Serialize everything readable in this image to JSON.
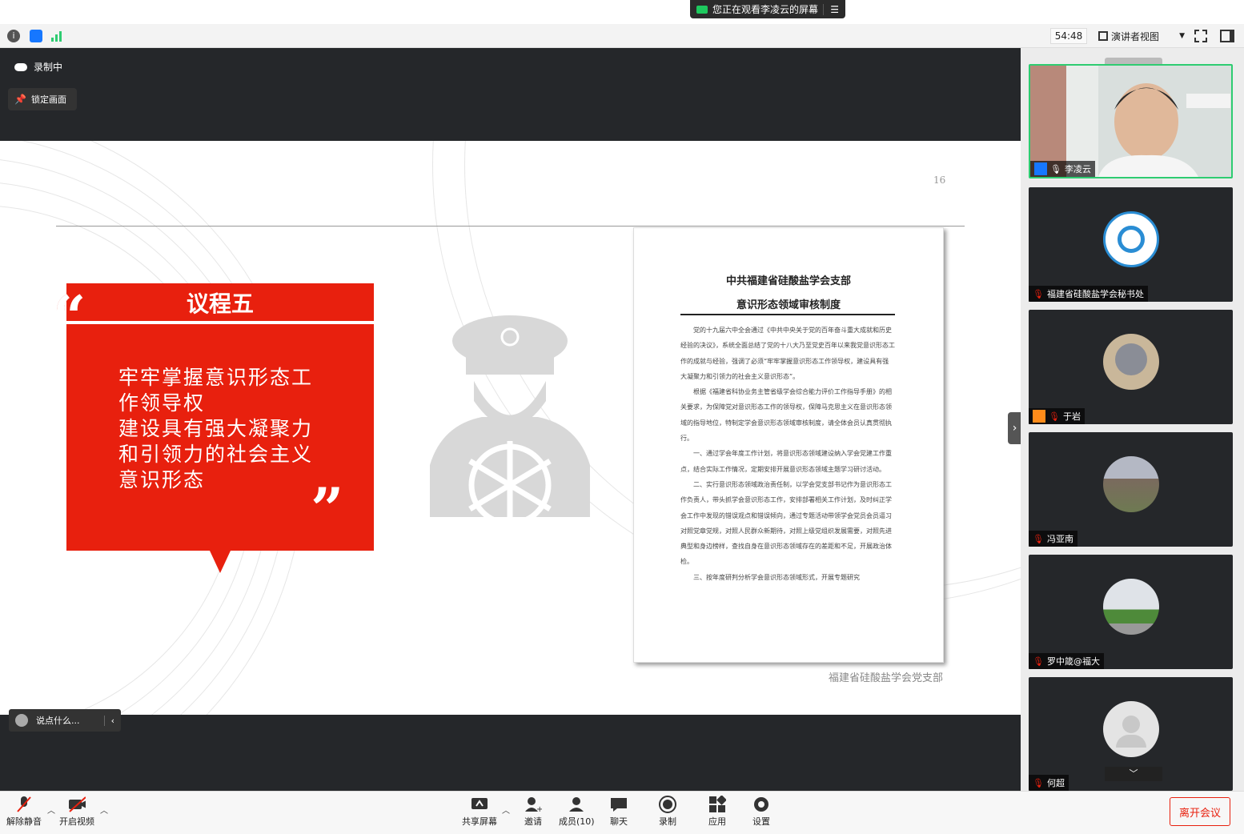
{
  "share_banner": {
    "text": "您正在观看李凌云的屏幕"
  },
  "topbar": {
    "timer": "54:48",
    "view_label": "演讲者视图"
  },
  "overlay": {
    "recording": "录制中",
    "lock_view": "锁定画面",
    "chat_placeholder": "说点什么..."
  },
  "slide": {
    "page_number": "16",
    "agenda_title": "议程五",
    "agenda_body": "牢牢掌握意识形态工作领导权建设具有强大凝聚力和引领力的社会主义意识形态",
    "agenda_lines": [
      "牢牢掌握意识形态工",
      "作领导权",
      "建设具有强大凝聚力",
      "和引领力的社会主义",
      "意识形态"
    ],
    "quote_open": "“",
    "quote_close": "”",
    "footer": "福建省硅酸盐学会党支部",
    "document": {
      "title_line1": "中共福建省硅酸盐学会支部",
      "title_line2": "意识形态领域审核制度",
      "paragraphs": [
        "党的十九届六中全会通过《中共中央关于党的百年奋斗重大成就和历史经验的决议》，系统全面总结了党的十八大乃至党史百年以来我党意识形态工作的成就与经验，强调了必须“牢牢掌握意识形态工作领导权，建设具有强大凝聚力和引领力的社会主义意识形态”。",
        "根据《福建省科协业务主管省级学会综合能力评价工作指导手册》的相关要求，为保障党对意识形态工作的领导权，保障马克思主义在意识形态领域的指导地位，特制定学会意识形态领域审核制度，请全体会员认真贯彻执行。",
        "一、通过学会年度工作计划，将意识形态领域建设纳入学会党建工作重点，结合实际工作情况，定期安排开展意识形态领域主题学习研讨活动。",
        "二、实行意识形态领域政治责任制，以学会党支部书记作为意识形态工作负责人，带头抓学会意识形态工作，安排部署相关工作计划，及时纠正学会工作中发现的错误观点和错误倾向，通过专题活动带领学会党员会员逼习对照党章党规，对照人民群众新期待，对照上级党组织发展需要，对照先进典型和身边榜样，查找自身在意识形态领域存在的差距和不足，开展政治体检。",
        "三、按年度研判分析学会意识形态领域形式，开展专题研究"
      ]
    }
  },
  "participants": [
    {
      "name": "李凌云",
      "type": "video"
    },
    {
      "name": "福建省硅酸盐学会秘书处",
      "type": "logo"
    },
    {
      "name": "于岩",
      "type": "cartoon"
    },
    {
      "name": "冯亚南",
      "type": "photo"
    },
    {
      "name": "罗中箴@福大",
      "type": "photo"
    },
    {
      "name": "何超",
      "type": "default"
    }
  ],
  "toolbar": {
    "unmute": "解除静音",
    "start_video": "开启视频",
    "share": "共享屏幕",
    "invite": "邀请",
    "members": "成员(10)",
    "chat": "聊天",
    "record": "录制",
    "apps": "应用",
    "settings": "设置",
    "leave": "离开会议"
  },
  "colors": {
    "accent_red": "#e8200e",
    "green": "#2ecc71",
    "dark_bg": "#25272a"
  }
}
